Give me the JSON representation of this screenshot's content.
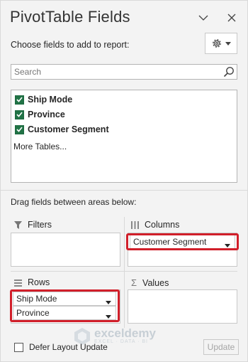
{
  "header": {
    "title": "PivotTable Fields",
    "choose_label": "Choose fields to add to report:"
  },
  "search": {
    "placeholder": "Search"
  },
  "fields": [
    {
      "label": "Ship Mode",
      "checked": true
    },
    {
      "label": "Province",
      "checked": true
    },
    {
      "label": "Customer Segment",
      "checked": true
    }
  ],
  "more_tables": "More Tables...",
  "drag_label": "Drag fields between areas below:",
  "areas": {
    "filters": {
      "label": "Filters",
      "items": []
    },
    "columns": {
      "label": "Columns",
      "items": [
        "Customer Segment"
      ]
    },
    "rows": {
      "label": "Rows",
      "items": [
        "Ship Mode",
        "Province"
      ]
    },
    "values": {
      "label": "Values",
      "items": []
    }
  },
  "footer": {
    "defer_label": "Defer Layout Update",
    "update_label": "Update"
  },
  "watermark": {
    "name": "exceldemy",
    "tagline": "EXCEL · DATA · BI"
  },
  "colors": {
    "checkbox": "#217346",
    "highlight": "#d11f2a"
  }
}
